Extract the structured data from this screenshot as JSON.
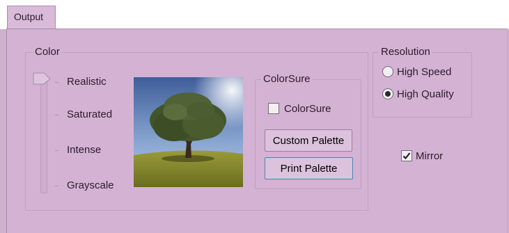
{
  "tabs": [
    {
      "label": "Output",
      "selected": true
    }
  ],
  "color_group": {
    "title": "Color",
    "levels": [
      "Realistic",
      "Saturated",
      "Intense",
      "Grayscale"
    ],
    "selected_level": "Realistic"
  },
  "colorsure_group": {
    "title": "ColorSure",
    "checkbox_label": "ColorSure",
    "checkbox_checked": false,
    "custom_palette_label": "Custom Palette",
    "print_palette_label": "Print Palette"
  },
  "resolution_group": {
    "title": "Resolution",
    "options": [
      {
        "label": "High Speed",
        "selected": false
      },
      {
        "label": "High Quality",
        "selected": true
      }
    ]
  },
  "mirror": {
    "label": "Mirror",
    "checked": true
  },
  "colors": {
    "background": "#cfb0cf",
    "panel": "#d4b2d4",
    "accent": "#5a7ea6"
  }
}
